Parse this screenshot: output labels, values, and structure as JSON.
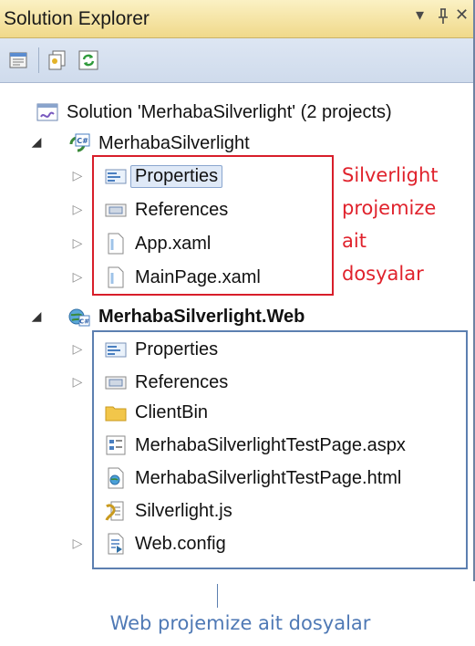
{
  "window": {
    "title": "Solution Explorer",
    "controls": {
      "dropdown": "▾",
      "pin": "ᵽ",
      "close": "✕"
    }
  },
  "toolbar": {
    "buttons": [
      "properties-icon",
      "show-all-files-icon",
      "refresh-icon"
    ]
  },
  "tree": {
    "solution": {
      "label": "Solution 'MerhabaSilverlight' (2 projects)",
      "icon": "solution-icon"
    },
    "project1": {
      "label": "MerhabaSilverlight",
      "icon": "csharp-project-icon",
      "items": [
        {
          "label": "Properties",
          "icon": "properties-folder-icon",
          "expandable": true,
          "selected": true
        },
        {
          "label": "References",
          "icon": "references-folder-icon",
          "expandable": true
        },
        {
          "label": "App.xaml",
          "icon": "xaml-file-icon",
          "expandable": true
        },
        {
          "label": "MainPage.xaml",
          "icon": "xaml-file-icon",
          "expandable": true
        }
      ]
    },
    "project2": {
      "label": "MerhabaSilverlight.Web",
      "icon": "web-project-icon",
      "items": [
        {
          "label": "Properties",
          "icon": "properties-folder-icon",
          "expandable": true
        },
        {
          "label": "References",
          "icon": "references-folder-icon",
          "expandable": true
        },
        {
          "label": "ClientBin",
          "icon": "folder-icon",
          "expandable": false
        },
        {
          "label": "MerhabaSilverlightTestPage.aspx",
          "icon": "aspx-file-icon",
          "expandable": false
        },
        {
          "label": "MerhabaSilverlightTestPage.html",
          "icon": "html-file-icon",
          "expandable": false
        },
        {
          "label": "Silverlight.js",
          "icon": "js-file-icon",
          "expandable": false
        },
        {
          "label": "Web.config",
          "icon": "config-file-icon",
          "expandable": true
        }
      ]
    }
  },
  "annotations": {
    "red_note": [
      "Silverlight",
      "projemize",
      "ait",
      "dosyalar"
    ],
    "blue_note": "Web projemize ait dosyalar",
    "colors": {
      "red": "#e0222c",
      "blue": "#4f79b5"
    }
  }
}
